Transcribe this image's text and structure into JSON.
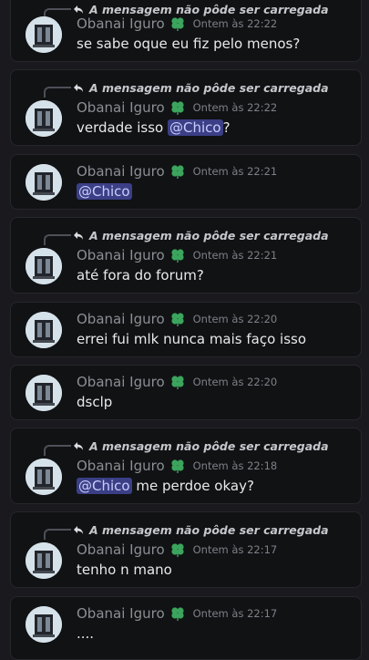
{
  "reply_text": "A mensagem não pôde ser carregada",
  "author": "Obanai Iguro",
  "badge_icon": "green-clover-badge",
  "messages": [
    {
      "time": "Ontem às 22:22",
      "pre": "se sabe oque eu fiz pelo menos?",
      "mention": "",
      "post": ""
    },
    {
      "time": "Ontem às 22:22",
      "pre": "verdade isso ",
      "mention": "@Chico",
      "post": "?"
    },
    {
      "time": "Ontem às 22:21",
      "pre": "",
      "mention": "@Chico",
      "post": ""
    },
    {
      "time": "Ontem às 22:21",
      "pre": "até fora do forum?",
      "mention": "",
      "post": ""
    },
    {
      "time": "Ontem às 22:20",
      "pre": "errei fui mlk nunca mais faço isso",
      "mention": "",
      "post": ""
    },
    {
      "time": "Ontem às 22:20",
      "pre": "dsclp",
      "mention": "",
      "post": ""
    },
    {
      "time": "Ontem às 22:18",
      "pre": "",
      "mention": "@Chico",
      "post": " me perdoe okay?"
    },
    {
      "time": "Ontem às 22:17",
      "pre": "tenho n mano",
      "mention": "",
      "post": ""
    },
    {
      "time": "Ontem às 22:17",
      "pre": "....",
      "mention": "",
      "post": ""
    }
  ]
}
